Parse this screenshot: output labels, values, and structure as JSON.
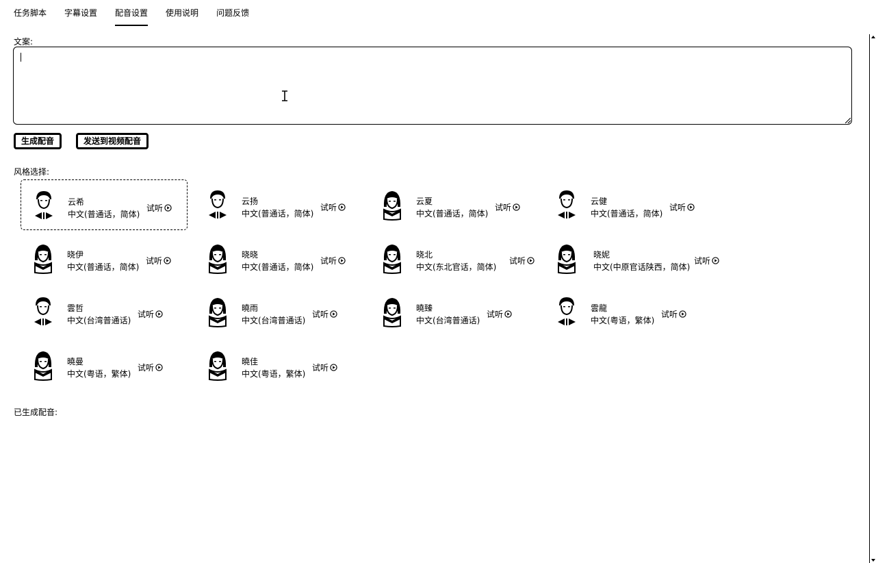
{
  "tabs": [
    {
      "label": "任务脚本",
      "active": false
    },
    {
      "label": "字幕设置",
      "active": false
    },
    {
      "label": "配音设置",
      "active": true
    },
    {
      "label": "使用说明",
      "active": false
    },
    {
      "label": "问题反馈",
      "active": false
    }
  ],
  "copy": {
    "label": "文案:",
    "value": ""
  },
  "buttons": {
    "generate": "生成配音",
    "send": "发送到视频配音"
  },
  "style": {
    "label": "风格选择:",
    "listen_label": "试听"
  },
  "voices": [
    {
      "name": "云希",
      "lang": "中文(普通话，简体)",
      "avatar": "male",
      "selected": true
    },
    {
      "name": "云扬",
      "lang": "中文(普通话，简体)",
      "avatar": "male"
    },
    {
      "name": "云夏",
      "lang": "中文(普通话，简体)",
      "avatar": "female"
    },
    {
      "name": "云健",
      "lang": "中文(普通话，简体)",
      "avatar": "male"
    },
    {
      "name": "晓伊",
      "lang": "中文(普通话，简体)",
      "avatar": "female"
    },
    {
      "name": "晓晓",
      "lang": "中文(普通话，简体)",
      "avatar": "female"
    },
    {
      "name": "晓北",
      "lang": "中文(东北官话，简体)",
      "avatar": "female"
    },
    {
      "name": "晓妮",
      "lang": "中文(中原官话陕西，简体)",
      "avatar": "female"
    },
    {
      "name": "雲哲",
      "lang": "中文(台湾普通话)",
      "avatar": "male"
    },
    {
      "name": "曉雨",
      "lang": "中文(台湾普通话)",
      "avatar": "female"
    },
    {
      "name": "曉臻",
      "lang": "中文(台湾普通话)",
      "avatar": "female"
    },
    {
      "name": "雲龍",
      "lang": "中文(粤语，繁体)",
      "avatar": "male"
    },
    {
      "name": "曉曼",
      "lang": "中文(粤语，繁体)",
      "avatar": "female"
    },
    {
      "name": "曉佳",
      "lang": "中文(粤语，繁体)",
      "avatar": "female"
    }
  ],
  "generated": {
    "label": "已生成配音:"
  }
}
